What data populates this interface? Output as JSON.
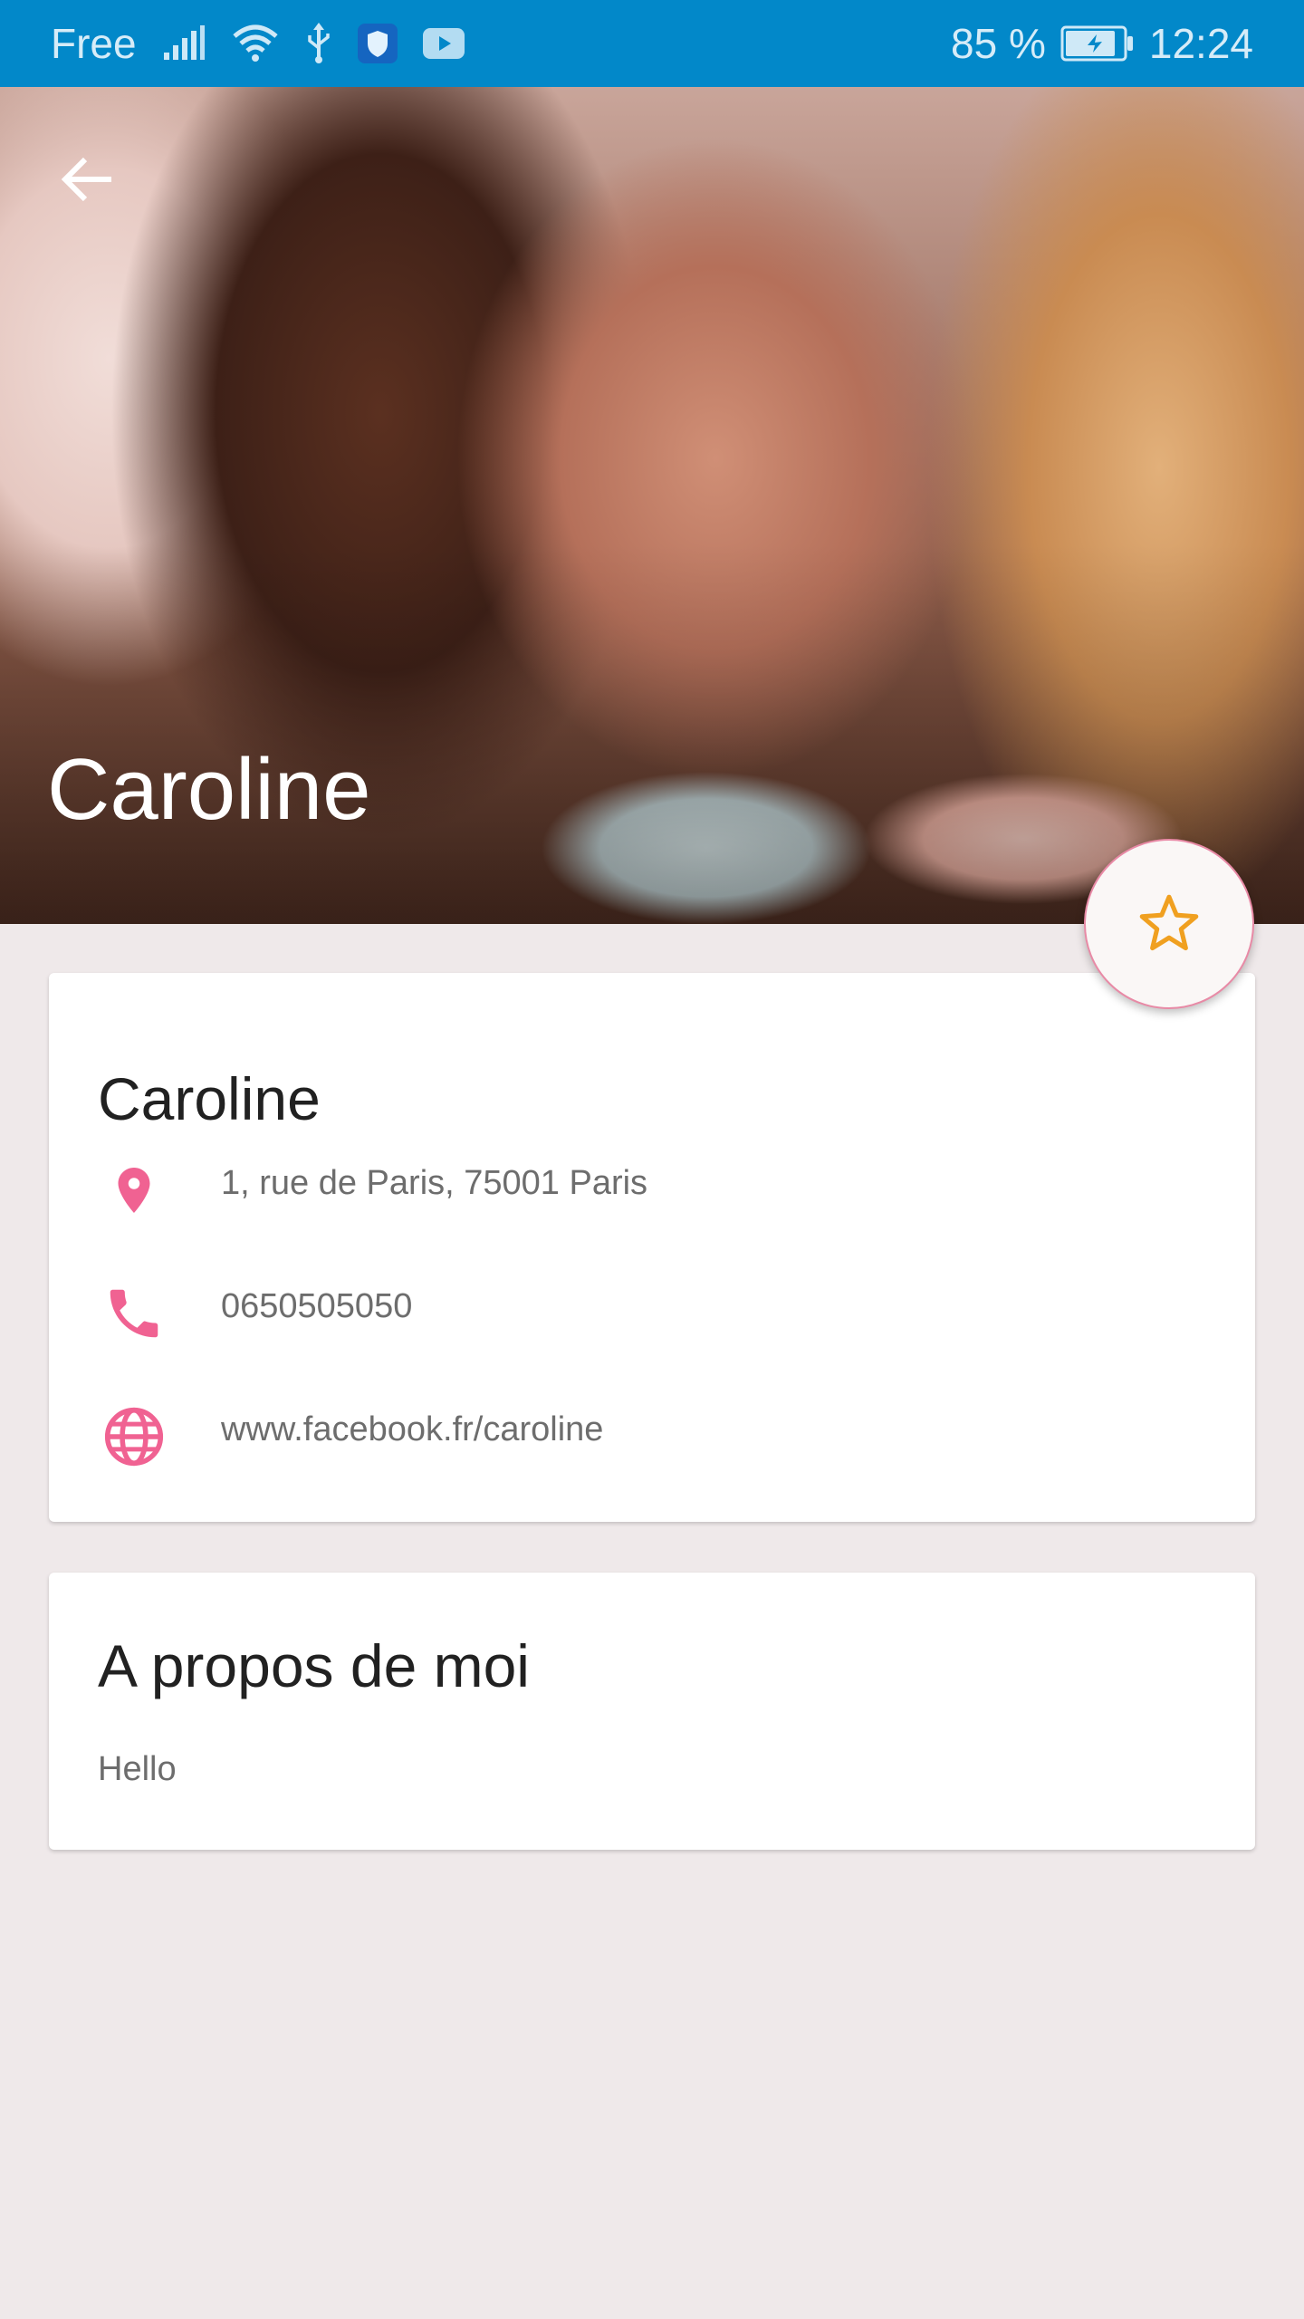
{
  "status_bar": {
    "carrier": "Free",
    "battery_percent": "85 %",
    "time": "12:24",
    "icons": [
      "signal-icon",
      "wifi-icon",
      "usb-icon",
      "shield-icon",
      "youtube-icon",
      "battery-icon"
    ]
  },
  "hero": {
    "title": "Caroline",
    "back_icon": "arrow-back-icon"
  },
  "fab": {
    "icon": "star-outline-icon",
    "icon_color": "#f0a020"
  },
  "contact_card": {
    "name": "Caroline",
    "address": "1, rue de Paris, 75001 Paris",
    "phone": "0650505050",
    "website": "www.facebook.fr/caroline",
    "icon_color": "#f06292"
  },
  "about_card": {
    "title": "A propos de moi",
    "text": "Hello"
  },
  "colors": {
    "status_bar": "#0288c9",
    "background": "#efe9ea",
    "accent": "#f06292"
  }
}
